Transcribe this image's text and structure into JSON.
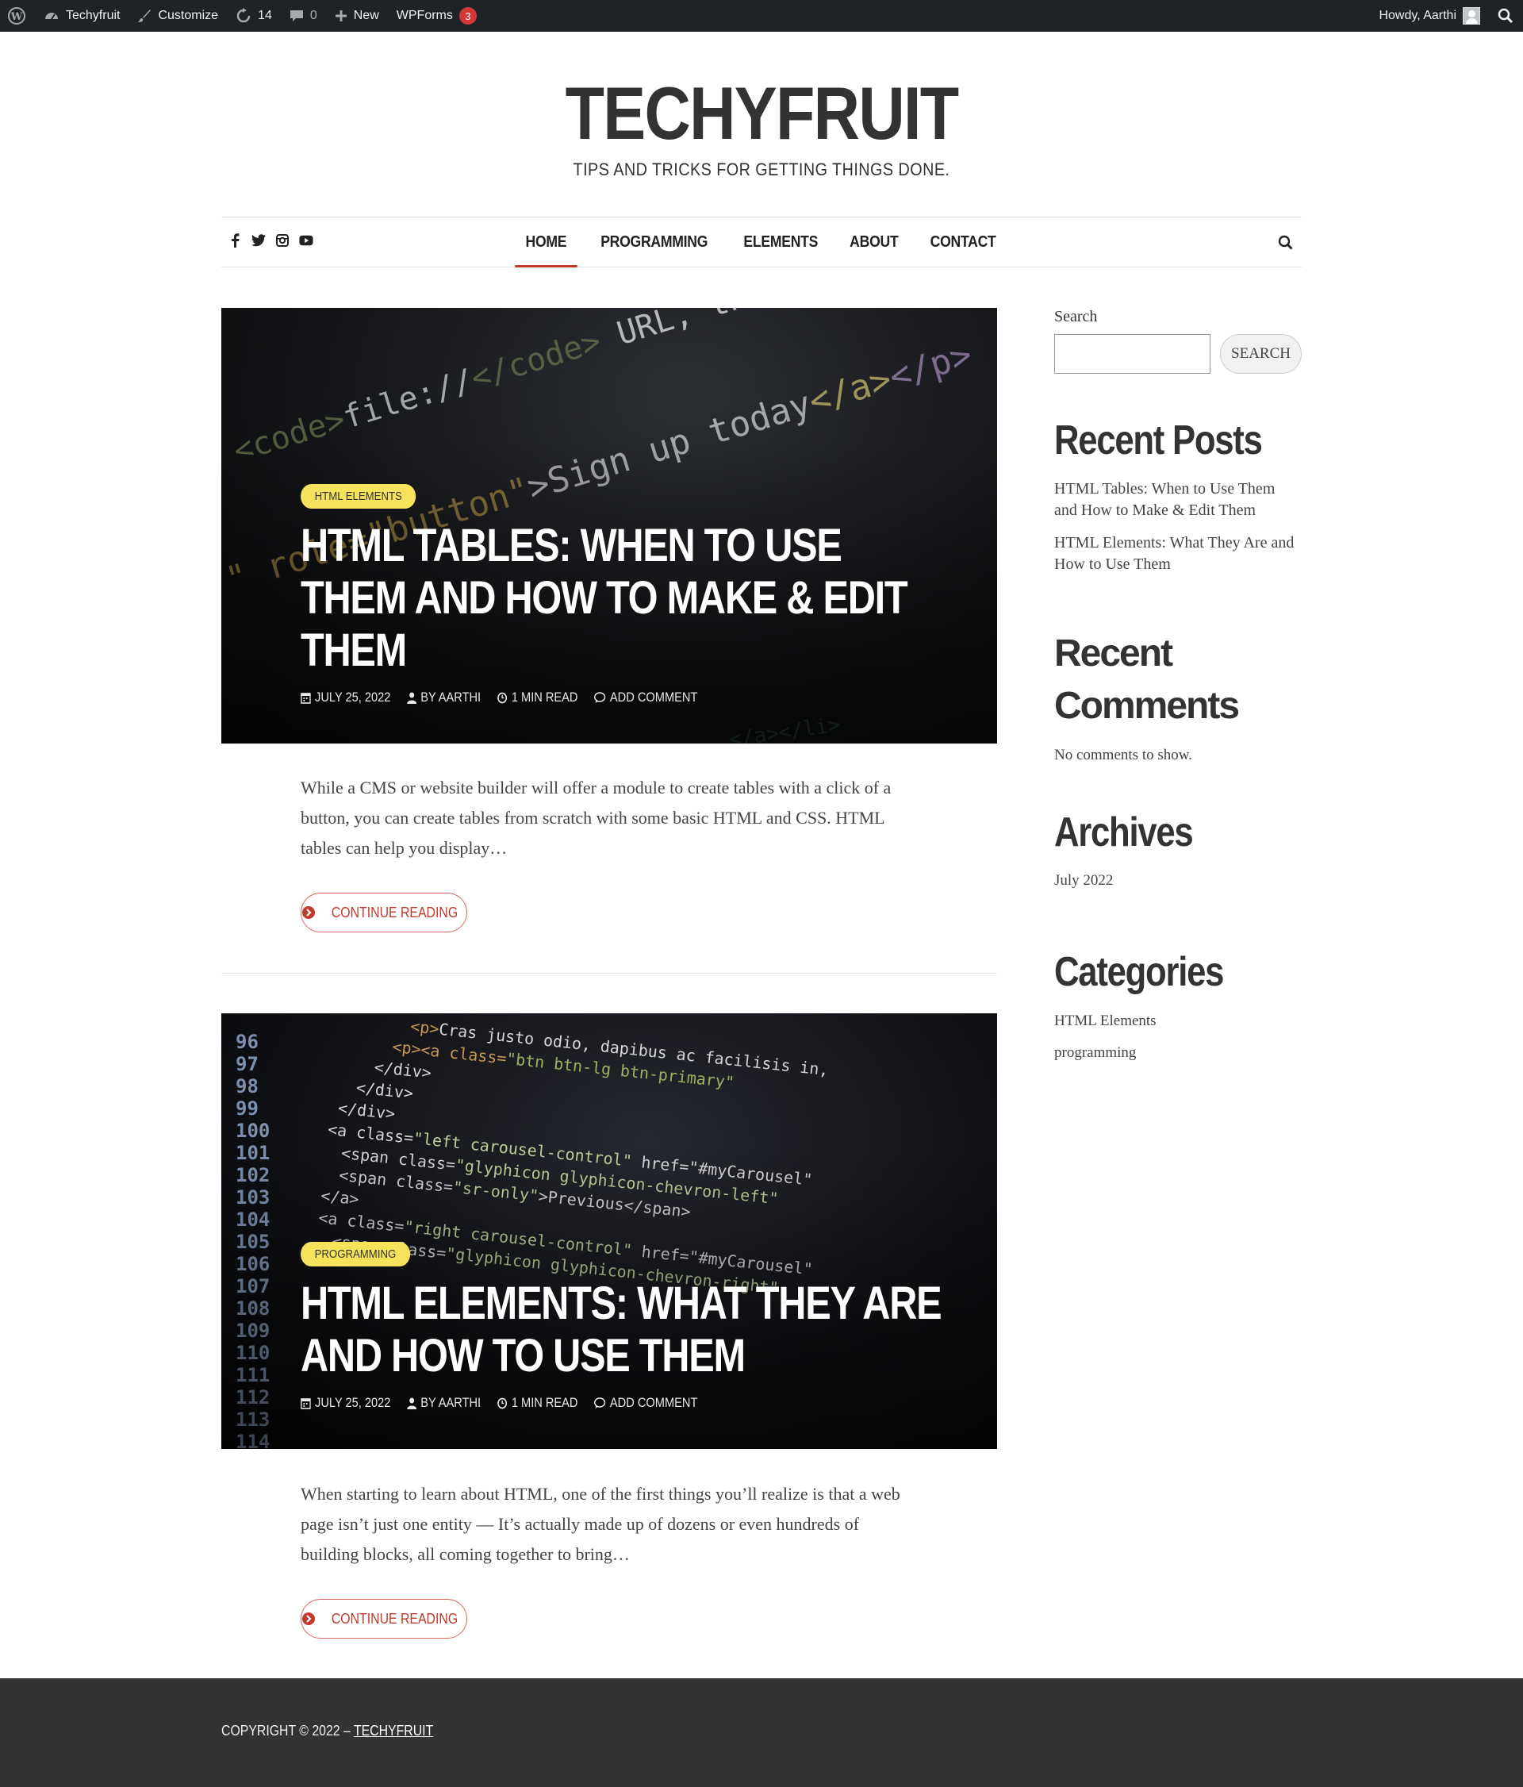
{
  "admin_bar": {
    "site_name": "Techyfruit",
    "customize": "Customize",
    "updates_count": "14",
    "comments_count": "0",
    "new_label": "New",
    "wpforms_label": "WPForms",
    "wpforms_badge": "3",
    "howdy": "Howdy, Aarthi"
  },
  "header": {
    "site_title": "TECHYFRUIT",
    "tagline": "TIPS AND TRICKS FOR GETTING THINGS DONE."
  },
  "nav": {
    "social_icons": [
      "facebook-icon",
      "twitter-icon",
      "instagram-icon",
      "youtube-icon"
    ],
    "items": [
      {
        "label": "HOME",
        "active": true
      },
      {
        "label": "PROGRAMMING",
        "active": false
      },
      {
        "label": "ELEMENTS",
        "active": false
      },
      {
        "label": "ABOUT",
        "active": false
      },
      {
        "label": "CONTACT",
        "active": false
      }
    ]
  },
  "posts": [
    {
      "category": "HTML ELEMENTS",
      "title": "HTML TABLES: WHEN TO USE THEM AND HOW TO MAKE & EDIT THEM",
      "date": "JULY 25, 2022",
      "author": "BY AARTHI",
      "read_time": "1 MIN READ",
      "comment": "ADD COMMENT",
      "excerpt": "While a CMS or website builder will offer a module to create tables with a click of a button, you can create tables from scratch with some basic HTML and CSS. HTML tables can help you display…",
      "continue": "CONTINUE READING"
    },
    {
      "category": "PROGRAMMING",
      "title": "HTML ELEMENTS: WHAT THEY ARE AND HOW TO USE THEM",
      "date": "JULY 25, 2022",
      "author": "BY AARTHI",
      "read_time": "1 MIN READ",
      "comment": "ADD COMMENT",
      "excerpt": "When starting to learn about HTML, one of the first things you’ll realize is that a web page isn’t just one entity — It’s actually made up of dozens or even hundreds of building blocks, all coming together to bring…",
      "continue": "CONTINUE READING"
    }
  ],
  "sidebar": {
    "search_label": "Search",
    "search_button": "SEARCH",
    "search_value": "",
    "recent_posts_title": "Recent Posts",
    "recent_posts": [
      "HTML Tables: When to Use Them and How to Make & Edit Them",
      "HTML Elements: What They Are and How to Use Them"
    ],
    "recent_comments_title": "Recent Comments",
    "no_comments": "No comments to show.",
    "archives_title": "Archives",
    "archives": [
      "July 2022"
    ],
    "categories_title": "Categories",
    "categories": [
      "HTML Elements",
      "programming"
    ]
  },
  "footer": {
    "copyright": "COPYRIGHT © 2022 –",
    "site_link": "TECHYFRUIT"
  },
  "colors": {
    "admin_bar_bg": "#1d2327",
    "accent_red": "#c0392b",
    "badge_yellow": "#f7e35b",
    "footer_bg": "#333333"
  }
}
